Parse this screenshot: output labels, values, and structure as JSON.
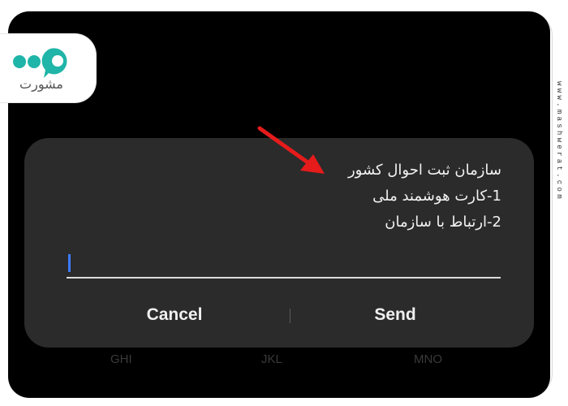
{
  "logo": {
    "text": "مشورت",
    "icon": "brand-logo-icon",
    "brand_color": "#1fb5a8"
  },
  "watermark": {
    "text": "www.mashwerat.com"
  },
  "keypad_hints": [
    "GHI",
    "JKL",
    "MNO"
  ],
  "dialog": {
    "message_lines": [
      "سازمان ثبت احوال کشور",
      "1-کارت هوشمند ملی",
      "2-ارتباط با سازمان"
    ],
    "input": {
      "value": "",
      "placeholder": ""
    },
    "cancel_label": "Cancel",
    "send_label": "Send"
  },
  "colors": {
    "screen_bg": "#000000",
    "dialog_bg": "#2b2b2b",
    "caret": "#3d7bff",
    "arrow": "#e61b1b"
  },
  "annotation": {
    "icon": "red-arrow-icon"
  }
}
